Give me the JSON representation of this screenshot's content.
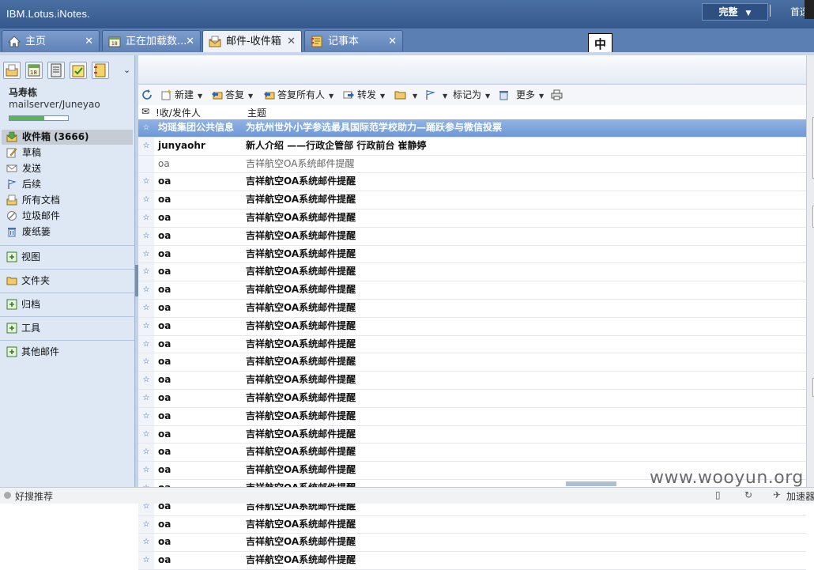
{
  "app": {
    "brand": "IBM.Lotus.iNotes.",
    "mode_button": "完整",
    "preferences_link": "首选"
  },
  "tabs": [
    {
      "label": "主页",
      "icon": "home-icon",
      "active": false
    },
    {
      "label": "正在加载数...",
      "icon": "calendar-icon",
      "active": false
    },
    {
      "label": "邮件-收件箱",
      "icon": "mail-icon",
      "active": true
    },
    {
      "label": "记事本",
      "icon": "notebook-icon",
      "active": false
    }
  ],
  "ime_indicator": "中",
  "user": {
    "name": "马寿栋",
    "server": "mailserver/Juneyao",
    "quota_fraction": 0.6
  },
  "nav": {
    "items": [
      {
        "label": "收件箱 (3666)",
        "icon": "inbox-icon",
        "selected": true
      },
      {
        "label": "草稿",
        "icon": "draft-icon",
        "selected": false
      },
      {
        "label": "发送",
        "icon": "sent-icon",
        "selected": false
      },
      {
        "label": "后续",
        "icon": "follow-up-flag-icon",
        "selected": false
      },
      {
        "label": "所有文档",
        "icon": "all-documents-icon",
        "selected": false
      },
      {
        "label": "垃圾邮件",
        "icon": "junk-icon",
        "selected": false
      },
      {
        "label": "废纸篓",
        "icon": "trash-icon",
        "selected": false
      }
    ],
    "sections": [
      {
        "label": "视图",
        "icon": "views-icon"
      },
      {
        "label": "文件夹",
        "icon": "folder-icon"
      },
      {
        "label": "归档",
        "icon": "archive-icon"
      },
      {
        "label": "工具",
        "icon": "tools-icon"
      },
      {
        "label": "其他邮件",
        "icon": "other-mail-icon"
      }
    ]
  },
  "toolbar": {
    "new": "新建",
    "reply": "答复",
    "reply_all": "答复所有人",
    "forward": "转发",
    "mark_as": "标记为",
    "more": "更多"
  },
  "columns": {
    "from": "!收/发件人",
    "subject": "主题"
  },
  "messages": [
    {
      "from": "均瑶集团公共信息",
      "subject": "为杭州世外小学参选最具国际范学校助力—踊跃参与微信投票",
      "state": "selected"
    },
    {
      "from": "junyaohr",
      "subject": "新人介绍 ——行政企管部 行政前台 崔静婷",
      "state": "unread"
    },
    {
      "from": "oa",
      "subject": "吉祥航空OA系统邮件提醒",
      "state": "read"
    },
    {
      "from": "oa",
      "subject": "吉祥航空OA系统邮件提醒",
      "state": "unread"
    },
    {
      "from": "oa",
      "subject": "吉祥航空OA系统邮件提醒",
      "state": "unread"
    },
    {
      "from": "oa",
      "subject": "吉祥航空OA系统邮件提醒",
      "state": "unread"
    },
    {
      "from": "oa",
      "subject": "吉祥航空OA系统邮件提醒",
      "state": "unread"
    },
    {
      "from": "oa",
      "subject": "吉祥航空OA系统邮件提醒",
      "state": "unread"
    },
    {
      "from": "oa",
      "subject": "吉祥航空OA系统邮件提醒",
      "state": "unread"
    },
    {
      "from": "oa",
      "subject": "吉祥航空OA系统邮件提醒",
      "state": "unread"
    },
    {
      "from": "oa",
      "subject": "吉祥航空OA系统邮件提醒",
      "state": "unread"
    },
    {
      "from": "oa",
      "subject": "吉祥航空OA系统邮件提醒",
      "state": "unread"
    },
    {
      "from": "oa",
      "subject": "吉祥航空OA系统邮件提醒",
      "state": "unread"
    },
    {
      "from": "oa",
      "subject": "吉祥航空OA系统邮件提醒",
      "state": "unread"
    },
    {
      "from": "oa",
      "subject": "吉祥航空OA系统邮件提醒",
      "state": "unread"
    },
    {
      "from": "oa",
      "subject": "吉祥航空OA系统邮件提醒",
      "state": "unread"
    },
    {
      "from": "oa",
      "subject": "吉祥航空OA系统邮件提醒",
      "state": "unread"
    },
    {
      "from": "oa",
      "subject": "吉祥航空OA系统邮件提醒",
      "state": "unread"
    },
    {
      "from": "oa",
      "subject": "吉祥航空OA系统邮件提醒",
      "state": "unread"
    },
    {
      "from": "oa",
      "subject": "吉祥航空OA系统邮件提醒",
      "state": "unread"
    },
    {
      "from": "oa",
      "subject": "吉祥航空OA系统邮件提醒",
      "state": "unread"
    },
    {
      "from": "oa",
      "subject": "吉祥航空OA系统邮件提醒",
      "state": "unread"
    },
    {
      "from": "oa",
      "subject": "吉祥航空OA系统邮件提醒",
      "state": "unread"
    },
    {
      "from": "oa",
      "subject": "吉祥航空OA系统邮件提醒",
      "state": "unread"
    },
    {
      "from": "oa",
      "subject": "吉祥航空OA系统邮件提醒",
      "state": "unread"
    }
  ],
  "statusbar": {
    "left_text": "好搜推荐",
    "accelerator": "加速器"
  },
  "watermark": "www.wooyun.org",
  "colors": {
    "titlebar": "#3b5f92",
    "selected_row": "#7ba2da",
    "left_pane": "#dde8f4",
    "star": "#2a63b8"
  }
}
